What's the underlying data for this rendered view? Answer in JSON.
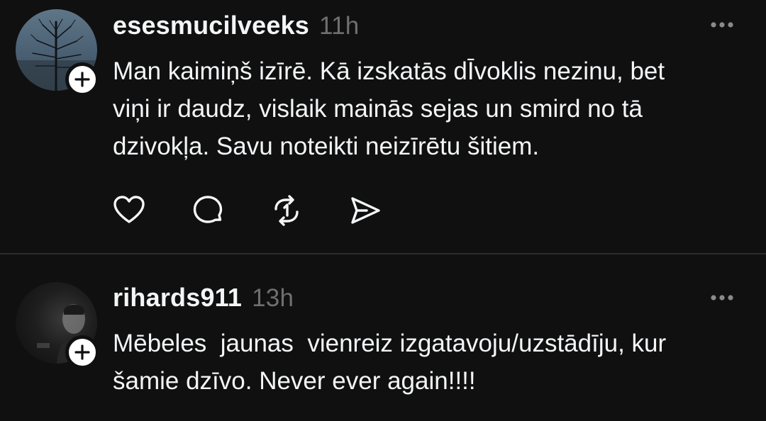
{
  "posts": [
    {
      "username": "esesmucilveeks",
      "time": "11h",
      "text": "Man kaimiņš izīrē. Kā izskatās dĪvoklis nezinu, bet\nviņi ir daudz, vislaik mainās sejas un smird no tā\ndzivokļa. Savu noteikti neizīrētu šitiem.",
      "actions": [
        "heart-icon",
        "comment-icon",
        "repost-icon",
        "share-icon"
      ]
    },
    {
      "username": "rihards911",
      "time": "13h",
      "text": "Mēbeles  jaunas  vienreiz izgatavoju/uzstādīju, kur\nšamie dzīvo. Never ever again!!!!"
    }
  ],
  "colors": {
    "background": "#101010",
    "text": "#f3f5f7",
    "muted": "#6f6f6f",
    "divider": "#2c2c2c"
  }
}
